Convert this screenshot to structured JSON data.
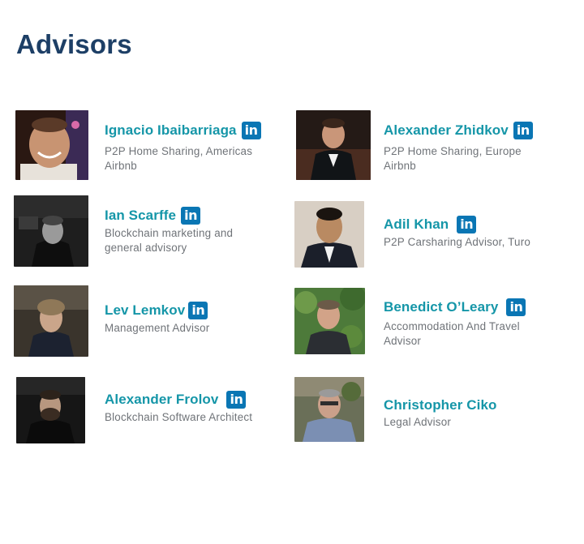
{
  "page": {
    "title": "Advisors"
  },
  "advisors": [
    {
      "name": "Ignacio Ibaibarriaga",
      "role_lines": [
        "P2P Home Sharing, Americas",
        "Airbnb"
      ],
      "linkedin": "in"
    },
    {
      "name": "Alexander Zhidkov",
      "role_lines": [
        "P2P Home Sharing, Europe",
        "Airbnb"
      ],
      "linkedin": "in"
    },
    {
      "name": "Ian Scarffe",
      "role_lines": [
        "Blockchain marketing and",
        "general advisory"
      ],
      "linkedin": "in"
    },
    {
      "name": "Adil Khan",
      "role_lines": [
        "P2P Carsharing Advisor, Turo"
      ],
      "linkedin": "in"
    },
    {
      "name": "Lev Lemkov",
      "role_lines": [
        "Management Advisor"
      ],
      "linkedin": "in"
    },
    {
      "name": "Benedict O’Leary",
      "role_lines": [
        "Accommodation And Travel",
        "Advisor"
      ],
      "linkedin": "in"
    },
    {
      "name": "Alexander Frolov",
      "role_lines": [
        "Blockchain Software Architect"
      ],
      "linkedin": "in"
    },
    {
      "name": "Christopher Ciko",
      "role_lines": [
        "Legal Advisor"
      ]
    }
  ],
  "colors": {
    "title": "#1d3f66",
    "name": "#1596a8",
    "role": "#6f7378",
    "linkedin": "#0a76b4"
  }
}
